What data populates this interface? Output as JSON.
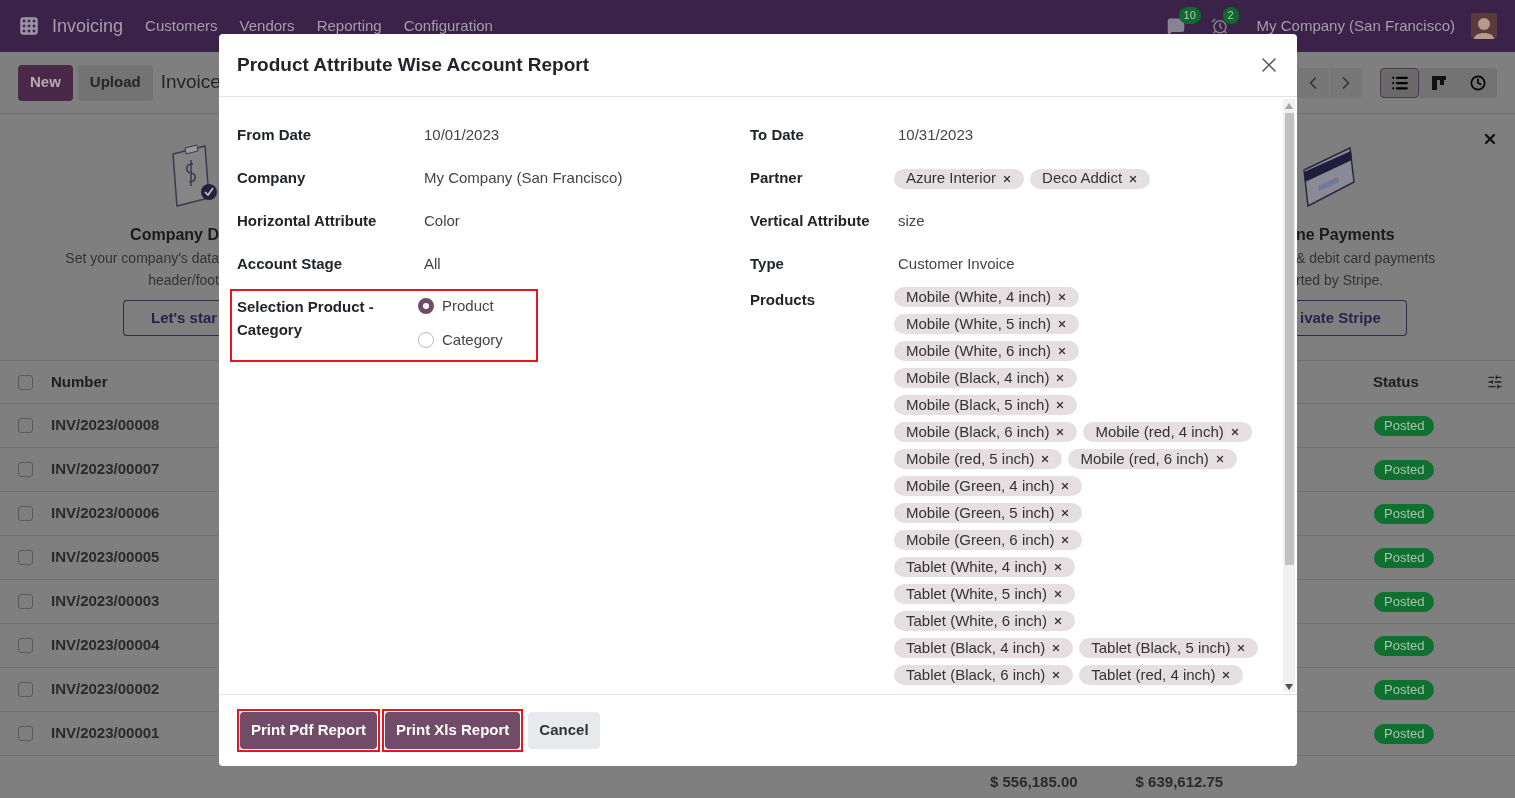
{
  "navbar": {
    "app_name": "Invoicing",
    "menu": [
      "Customers",
      "Vendors",
      "Reporting",
      "Configuration"
    ],
    "messages_badge": "10",
    "activities_badge": "2",
    "company": "My Company (San Francisco)"
  },
  "control_panel": {
    "buttons": [
      {
        "label": "New",
        "kind": "primary"
      },
      {
        "label": "Upload",
        "kind": "secondary"
      }
    ],
    "breadcrumb": "Invoice",
    "views": [
      {
        "kind": "list",
        "selected": true
      },
      {
        "kind": "kanban",
        "selected": false
      },
      {
        "kind": "activity",
        "selected": false
      }
    ]
  },
  "banners": [
    {
      "title": "Company D",
      "lines": [
        "Set your company's data",
        "header/foot"
      ],
      "button": "Let's star"
    },
    {
      "title": "ne Payments",
      "lines": [
        "& debit card payments",
        "rted by Stripe."
      ],
      "button": "ivate Stripe"
    }
  ],
  "table": {
    "columns": [
      "Number",
      "Status"
    ],
    "all_checked": false,
    "rows": [
      {
        "number": "INV/2023/00008",
        "status": "Posted",
        "checked": false
      },
      {
        "number": "INV/2023/00007",
        "status": "Posted",
        "checked": false
      },
      {
        "number": "INV/2023/00006",
        "status": "Posted",
        "checked": false
      },
      {
        "number": "INV/2023/00005",
        "status": "Posted",
        "checked": false
      },
      {
        "number": "INV/2023/00003",
        "status": "Posted",
        "checked": false
      },
      {
        "number": "INV/2023/00004",
        "status": "Posted",
        "checked": false
      },
      {
        "number": "INV/2023/00002",
        "status": "Posted",
        "checked": false
      },
      {
        "number": "INV/2023/00001",
        "status": "Posted",
        "checked": false
      }
    ],
    "totals": [
      "$ 556,185.00",
      "$ 639,612.75"
    ]
  },
  "dialog": {
    "title": "Product Attribute Wise Account Report",
    "left_fields": [
      {
        "label": "From Date",
        "value": "10/01/2023"
      },
      {
        "label": "Company",
        "value": "My Company (San Francisco)"
      },
      {
        "label": "Horizontal Attribute",
        "value": "Color"
      },
      {
        "label": "Account Stage",
        "value": "All"
      }
    ],
    "selection": {
      "label": "Selection Product - Category",
      "highlighted": true,
      "options": [
        {
          "label": "Product",
          "selected": true
        },
        {
          "label": "Category",
          "selected": false
        }
      ]
    },
    "right_fields": [
      {
        "label": "To Date",
        "kind": "text",
        "value": "10/31/2023"
      },
      {
        "label": "Partner",
        "kind": "tags",
        "tags": [
          "Azure Interior",
          "Deco Addict"
        ]
      },
      {
        "label": "Vertical Attribute",
        "kind": "text",
        "value": "size"
      },
      {
        "label": "Type",
        "kind": "text",
        "value": "Customer Invoice"
      },
      {
        "label": "Products",
        "kind": "tags",
        "tags": [
          "Mobile (White, 4 inch)",
          "Mobile (White, 5 inch)",
          "Mobile (White, 6 inch)",
          "Mobile (Black, 4 inch)",
          "Mobile (Black, 5 inch)",
          "Mobile (Black, 6 inch)",
          "Mobile (red, 4 inch)",
          "Mobile (red, 5 inch)",
          "Mobile (red, 6 inch)",
          "Mobile (Green, 4 inch)",
          "Mobile (Green, 5 inch)",
          "Mobile (Green, 6 inch)",
          "Tablet (White, 4 inch)",
          "Tablet (White, 5 inch)",
          "Tablet (White, 6 inch)",
          "Tablet (Black, 4 inch)",
          "Tablet (Black, 5 inch)",
          "Tablet (Black, 6 inch)",
          "Tablet (red, 4 inch)"
        ]
      }
    ],
    "buttons": [
      {
        "label": "Print Pdf Report",
        "kind": "primary",
        "highlighted": true
      },
      {
        "label": "Print Xls Report",
        "kind": "primary",
        "highlighted": true
      },
      {
        "label": "Cancel",
        "kind": "secondary",
        "highlighted": false
      }
    ]
  }
}
